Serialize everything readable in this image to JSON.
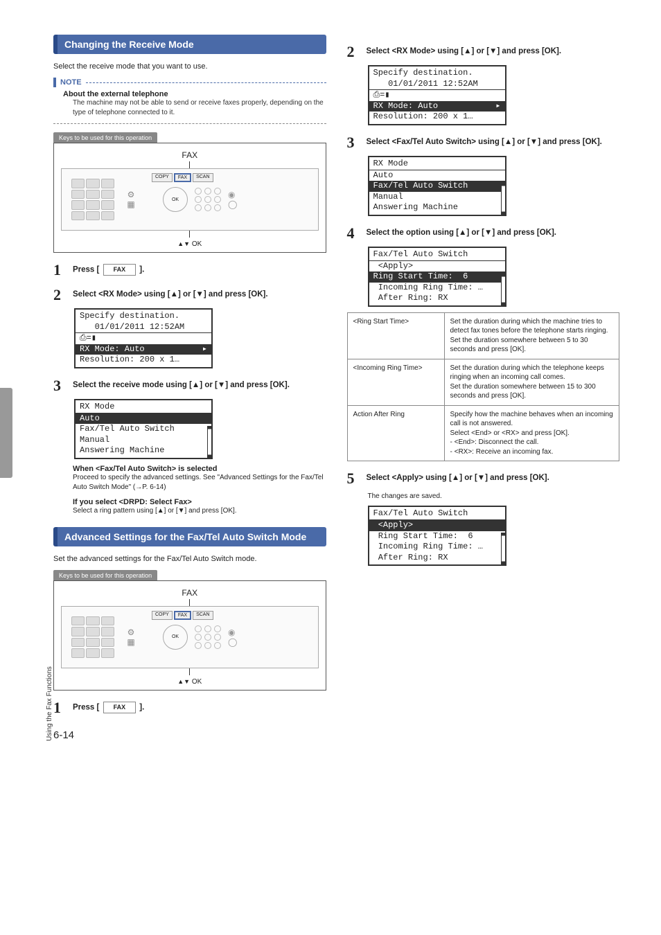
{
  "sidebar": {
    "chapter": "Using the Fax Functions"
  },
  "pageNumber": "6-14",
  "sec1": {
    "heading": "Changing the Receive Mode",
    "intro": "Select the receive mode that you want to use.",
    "noteLabel": "NOTE",
    "noteTitle": "About the external telephone",
    "noteBody": "The machine may not be able to send or receive faxes properly, depending on the type of telephone connected to it.",
    "keysBar": "Keys to be used for this operation",
    "faxLabel": "FAX",
    "okLabel": "OK",
    "step1_a": "Press [ ",
    "step1_key": "FAX",
    "step1_b": " ].",
    "step2": "Select <RX Mode> using [▲] or [▼] and press [OK].",
    "lcd1": {
      "l1": "Specify destination.",
      "l2": "   01/01/2011 12:52AM",
      "l3_icon": "⎙=▮",
      "l4": "RX Mode: Auto",
      "l5": "Resolution: 200 x 1…"
    },
    "step3": "Select the receive mode using [▲] or [▼] and press [OK].",
    "lcd2": {
      "l1": "RX Mode",
      "l2": "Auto",
      "l3": "Fax/Tel Auto Switch",
      "l4": "Manual",
      "l5": "Answering Machine"
    },
    "sub1_t": "When <Fax/Tel Auto Switch> is selected",
    "sub1_b": "Proceed to specify the advanced settings. See \"Advanced Settings for the Fax/Tel Auto Switch Mode\" (→P. 6-14)",
    "sub2_t": "If you select <DRPD: Select Fax>",
    "sub2_b": "Select a ring pattern  using [▲] or [▼] and press [OK]."
  },
  "sec2": {
    "heading": "Advanced Settings for the Fax/Tel Auto Switch Mode",
    "intro": "Set the advanced settings for the Fax/Tel Auto Switch mode.",
    "step1_a": "Press [ ",
    "step1_key": "FAX",
    "step1_b": " ].",
    "step2": "Select <RX Mode> using [▲] or [▼] and press [OK].",
    "lcd1": {
      "l1": "Specify destination.",
      "l2": "   01/01/2011 12:52AM",
      "l3_icon": "⎙=▮",
      "l4": "RX Mode: Auto",
      "l5": "Resolution: 200 x 1…"
    },
    "step3": "Select <Fax/Tel Auto Switch> using [▲] or [▼] and press [OK].",
    "lcd2": {
      "l1": "RX Mode",
      "l2": "Auto",
      "l3": "Fax/Tel Auto Switch",
      "l4": "Manual",
      "l5": "Answering Machine"
    },
    "step4": "Select the option using [▲] or [▼] and press [OK].",
    "lcd3": {
      "l1": "Fax/Tel Auto Switch",
      "l2": " <Apply>",
      "l3": "Ring Start Time:  6",
      "l4": " Incoming Ring Time: …",
      "l5": " After Ring: RX"
    },
    "table": {
      "r1k": "<Ring Start Time>",
      "r1v": "Set the duration during which the machine tries to detect fax tones before the telephone starts ringing.\nSet the duration somewhere between 5 to 30 seconds and press [OK].",
      "r2k": "<Incoming Ring Time>",
      "r2v": "Set the duration during which the telephone keeps ringing when an incoming call comes.\nSet the duration somewhere between 15 to 300 seconds and press [OK].",
      "r3k": "Action After Ring",
      "r3v": "Specify how the machine behaves when an incoming call is not answered.\nSelect <End> or <RX> and press [OK].\n-  <End>: Disconnect the call.\n-  <RX>: Receive an incoming fax."
    },
    "step5": "Select <Apply> using [▲] or [▼] and press [OK].",
    "step5_sub": "The changes are saved.",
    "lcd4": {
      "l1": "Fax/Tel Auto Switch",
      "l2": " <Apply>",
      "l3": " Ring Start Time:  6",
      "l4": " Incoming Ring Time: …",
      "l5": " After Ring: RX"
    }
  }
}
